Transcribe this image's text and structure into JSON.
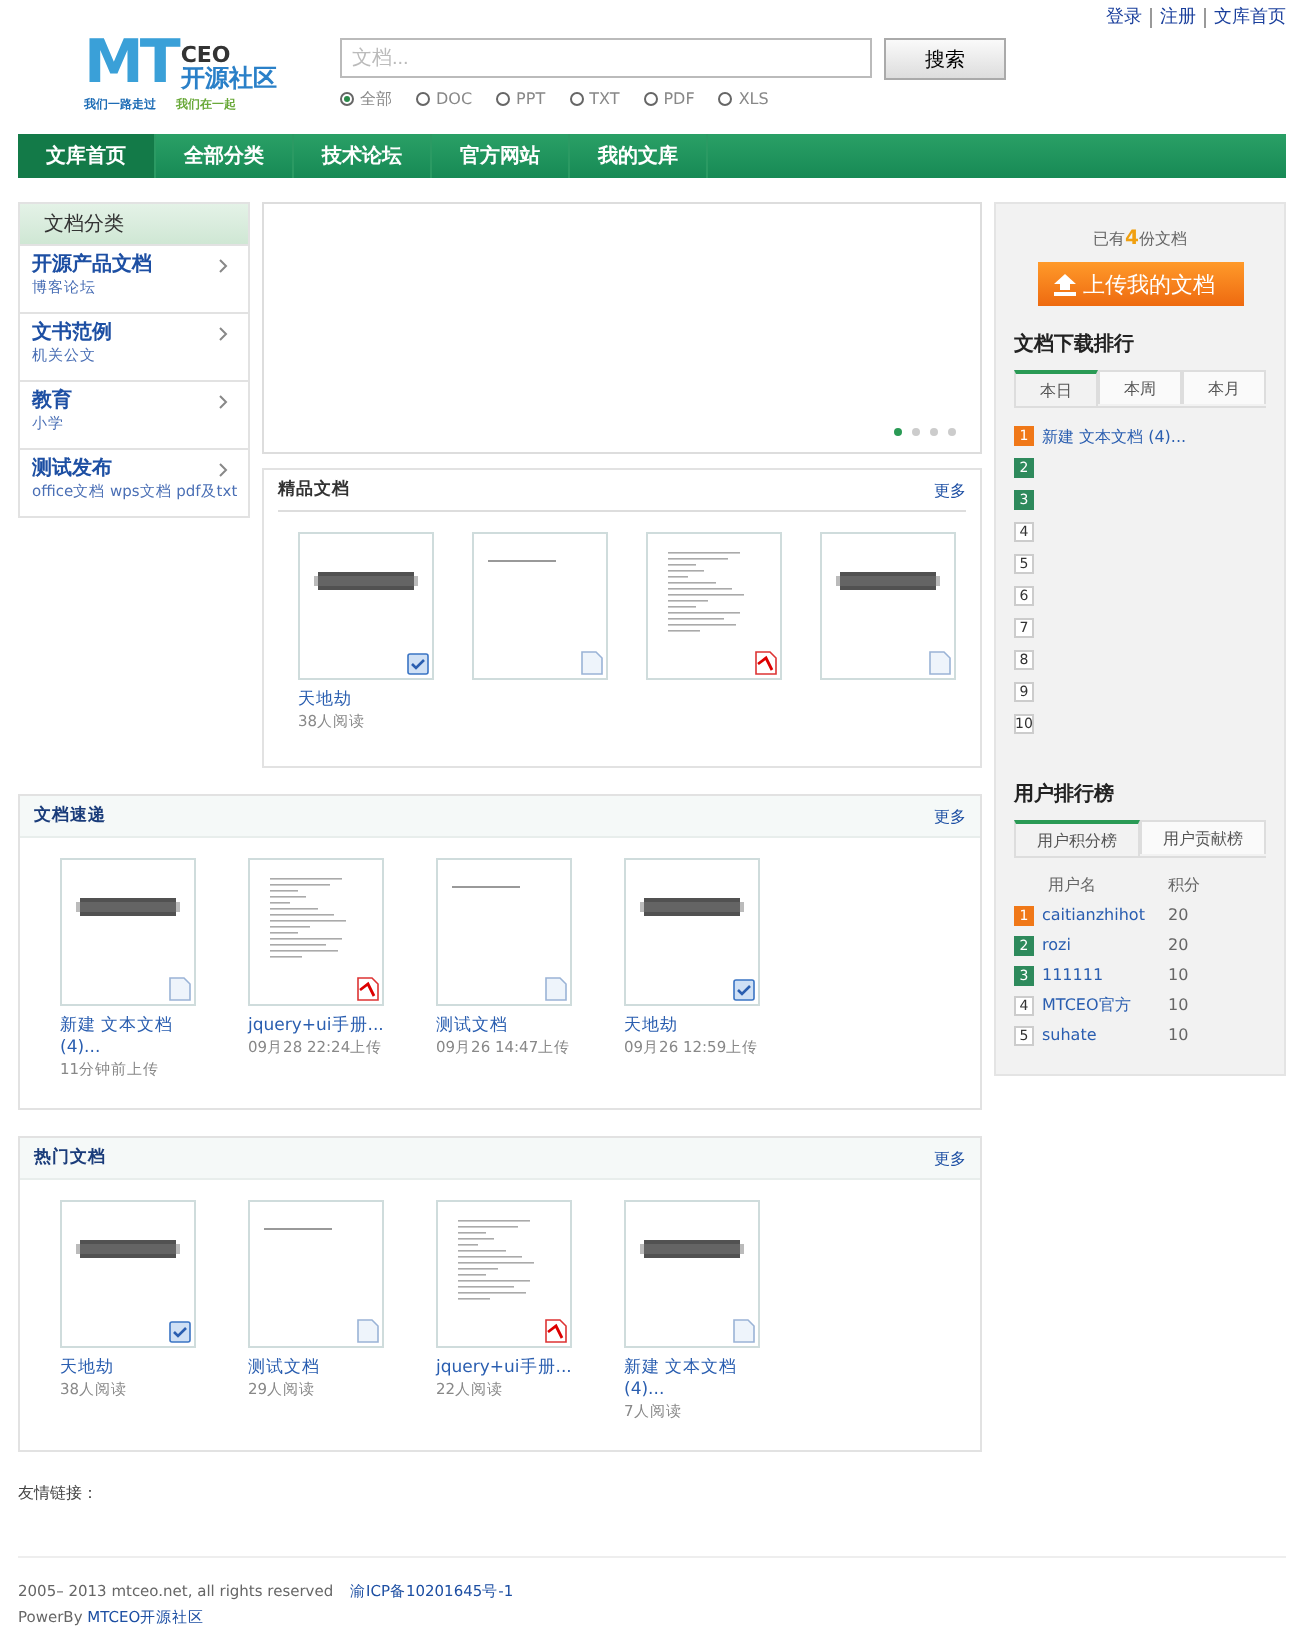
{
  "top_links": [
    "登录",
    "注册",
    "文库首页"
  ],
  "logo": {
    "mark": "MT",
    "sup": "CEO",
    "name": "开源社区",
    "slogans": [
      "我们一路走过",
      "我们在一起"
    ]
  },
  "search": {
    "placeholder": "文档...",
    "button": "搜索",
    "types": [
      {
        "label": "全部",
        "selected": true
      },
      {
        "label": "DOC",
        "selected": false
      },
      {
        "label": "PPT",
        "selected": false
      },
      {
        "label": "TXT",
        "selected": false
      },
      {
        "label": "PDF",
        "selected": false
      },
      {
        "label": "XLS",
        "selected": false
      }
    ]
  },
  "nav": [
    {
      "label": "文库首页",
      "selected": true
    },
    {
      "label": "全部分类",
      "selected": false
    },
    {
      "label": "技术论坛",
      "selected": false
    },
    {
      "label": "官方网站",
      "selected": false
    },
    {
      "label": "我的文库",
      "selected": false
    }
  ],
  "categories": {
    "title": "文档分类",
    "items": [
      {
        "name": "开源产品文档",
        "sub": "博客论坛"
      },
      {
        "name": "文书范例",
        "sub": "机关公文"
      },
      {
        "name": "教育",
        "sub": "小学"
      },
      {
        "name": "测试发布",
        "sub": "office文档 wps文档 pdf及txt"
      }
    ]
  },
  "slider": {
    "dots": [
      {
        "selected": true
      },
      {
        "selected": false
      },
      {
        "selected": false
      },
      {
        "selected": false
      }
    ]
  },
  "featured": {
    "title": "精品文档",
    "more": "更多",
    "docs": [
      {
        "kind": "cover",
        "file_icon": {
          "kind": "wps"
        },
        "title": "天地劫",
        "meta": "38人阅读"
      },
      {
        "kind": "blank",
        "file_icon": {
          "kind": "doc"
        }
      },
      {
        "kind": "text",
        "file_icon": {
          "kind": "pdf"
        }
      },
      {
        "kind": "cover",
        "file_icon": {
          "kind": "doc"
        }
      }
    ]
  },
  "stats": {
    "prefix": "已有",
    "count": "4",
    "suffix": "份文档"
  },
  "upload_button": "上传我的文档",
  "download_rank": {
    "title": "文档下载排行",
    "tabs": [
      {
        "label": "本日",
        "selected": true
      },
      {
        "label": "本周",
        "selected": false
      },
      {
        "label": "本月",
        "selected": false
      }
    ],
    "items": [
      {
        "rank": "1",
        "color": "#f07818",
        "title": "新建 文本文档 (4)..."
      },
      {
        "rank": "2",
        "color": "#2e8a5c"
      },
      {
        "rank": "3",
        "color": "#2e8a5c"
      },
      {
        "rank": "4",
        "color": "#ffffff"
      },
      {
        "rank": "5",
        "color": "#ffffff"
      },
      {
        "rank": "6",
        "color": "#ffffff"
      },
      {
        "rank": "7",
        "color": "#ffffff"
      },
      {
        "rank": "8",
        "color": "#ffffff"
      },
      {
        "rank": "9",
        "color": "#ffffff"
      },
      {
        "rank": "10",
        "color": "#ffffff"
      }
    ]
  },
  "user_rank": {
    "title": "用户排行榜",
    "tabs": [
      {
        "label": "用户积分榜",
        "selected": true
      },
      {
        "label": "用户贡献榜",
        "selected": false
      }
    ],
    "columns": [
      "用户名",
      "积分"
    ],
    "rows": [
      {
        "rank": "1",
        "color": "#f07818",
        "name": "caitianzhihot",
        "score": "20"
      },
      {
        "rank": "2",
        "color": "#2e8a5c",
        "name": "rozi",
        "score": "20"
      },
      {
        "rank": "3",
        "color": "#2e8a5c",
        "name": "111111",
        "score": "10"
      },
      {
        "rank": "4",
        "color": "#ffffff",
        "name": "MTCEO官方",
        "score": "10"
      },
      {
        "rank": "5",
        "color": "#ffffff",
        "name": "suhate",
        "score": "10"
      }
    ]
  },
  "recent": {
    "title": "文档速递",
    "more": "更多",
    "docs": [
      {
        "kind": "cover",
        "file_icon": {
          "kind": "doc"
        },
        "title": "新建 文本文档 (4)...",
        "meta": "11分钟前上传"
      },
      {
        "kind": "text",
        "file_icon": {
          "kind": "pdf"
        },
        "title": "jquery+ui手册...",
        "meta": "09月28 22:24上传"
      },
      {
        "kind": "blank",
        "file_icon": {
          "kind": "doc"
        },
        "title": "测试文档",
        "meta": "09月26 14:47上传"
      },
      {
        "kind": "cover",
        "file_icon": {
          "kind": "wps"
        },
        "title": "天地劫",
        "meta": "09月26 12:59上传"
      }
    ]
  },
  "hot": {
    "title": "热门文档",
    "more": "更多",
    "docs": [
      {
        "kind": "cover",
        "file_icon": {
          "kind": "wps"
        },
        "title": "天地劫",
        "meta": "38人阅读"
      },
      {
        "kind": "blank",
        "file_icon": {
          "kind": "doc"
        },
        "title": "测试文档",
        "meta": "29人阅读"
      },
      {
        "kind": "text",
        "file_icon": {
          "kind": "pdf"
        },
        "title": "jquery+ui手册...",
        "meta": "22人阅读"
      },
      {
        "kind": "cover",
        "file_icon": {
          "kind": "doc"
        },
        "title": "新建 文本文档 (4)...",
        "meta": "7人阅读"
      }
    ]
  },
  "friend_links": "友情链接：",
  "footer": {
    "copyright": "2005– 2013 mtceo.net, all rights reserved",
    "icp": "渝ICP备10201645号-1",
    "powered": "PowerBy",
    "powered_link": "MTCEO开源社区"
  }
}
